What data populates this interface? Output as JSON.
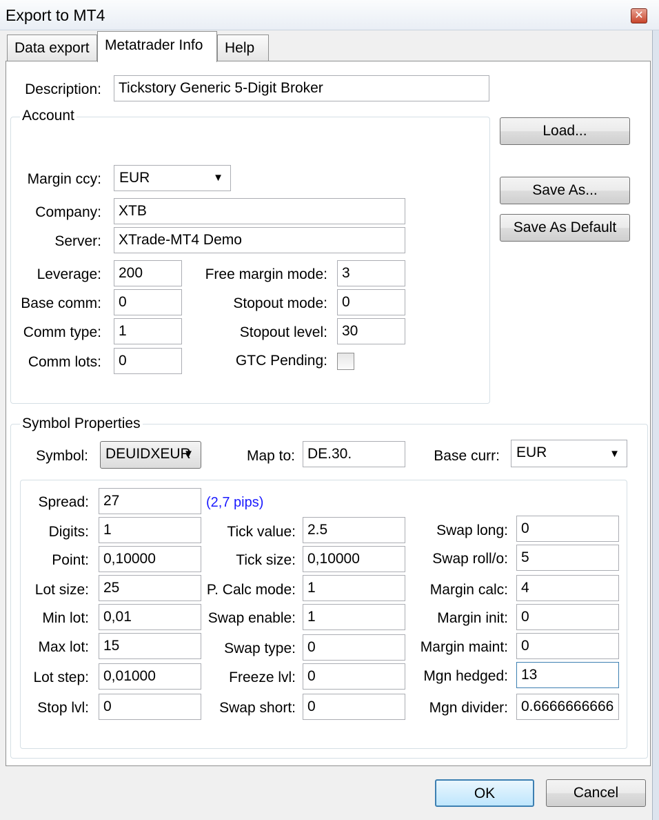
{
  "window": {
    "title": "Export to MT4",
    "close_glyph": "✕"
  },
  "tabs": [
    "Data export",
    "Metatrader Info",
    "Help"
  ],
  "description": {
    "label": "Description:",
    "value": "Tickstory Generic 5-Digit Broker"
  },
  "account": {
    "title": "Account",
    "margin_ccy": {
      "label": "Margin ccy:",
      "value": "EUR"
    },
    "company": {
      "label": "Company:",
      "value": "XTB"
    },
    "server": {
      "label": "Server:",
      "value": "XTrade-MT4 Demo"
    },
    "leverage": {
      "label": "Leverage:",
      "value": "200"
    },
    "base_comm": {
      "label": "Base comm:",
      "value": "0"
    },
    "comm_type": {
      "label": "Comm type:",
      "value": "1"
    },
    "comm_lots": {
      "label": "Comm lots:",
      "value": "0"
    },
    "free_margin_mode": {
      "label": "Free margin mode:",
      "value": "3"
    },
    "stopout_mode": {
      "label": "Stopout mode:",
      "value": "0"
    },
    "stopout_level": {
      "label": "Stopout level:",
      "value": "30"
    },
    "gtc_pending": {
      "label": "GTC Pending:",
      "checked": false
    }
  },
  "buttons": {
    "load": "Load...",
    "save_as": "Save As...",
    "save_default": "Save As Default",
    "ok": "OK",
    "cancel": "Cancel"
  },
  "symbol_props": {
    "title": "Symbol Properties",
    "symbol": {
      "label": "Symbol:",
      "value": "DEUIDXEUR"
    },
    "map_to": {
      "label": "Map to:",
      "value": "DE.30."
    },
    "base_curr": {
      "label": "Base curr:",
      "value": "EUR"
    },
    "spread": {
      "label": "Spread:",
      "value": "27",
      "note": "(2,7 pips)"
    },
    "col1": [
      {
        "label": "Digits:",
        "value": "1"
      },
      {
        "label": "Point:",
        "value": "0,10000"
      },
      {
        "label": "Lot size:",
        "value": "25"
      },
      {
        "label": "Min lot:",
        "value": "0,01"
      },
      {
        "label": "Max lot:",
        "value": "15"
      },
      {
        "label": "Lot step:",
        "value": "0,01000"
      },
      {
        "label": "Stop lvl:",
        "value": "0"
      }
    ],
    "col2": [
      {
        "label": "Tick value:",
        "value": "2.5"
      },
      {
        "label": "Tick size:",
        "value": "0,10000"
      },
      {
        "label": "P. Calc mode:",
        "value": "1"
      },
      {
        "label": "Swap enable:",
        "value": "1"
      },
      {
        "label": "Swap type:",
        "value": "0"
      },
      {
        "label": "Freeze lvl:",
        "value": "0"
      },
      {
        "label": "Swap short:",
        "value": "0"
      }
    ],
    "col3": [
      {
        "label": "Swap long:",
        "value": "0"
      },
      {
        "label": "Swap roll/o:",
        "value": "5"
      },
      {
        "label": "Margin calc:",
        "value": "4"
      },
      {
        "label": "Margin init:",
        "value": "0"
      },
      {
        "label": "Margin maint:",
        "value": "0"
      },
      {
        "label": "Mgn hedged:",
        "value": "13"
      },
      {
        "label": "Mgn divider:",
        "value": "0.6666666666"
      }
    ]
  }
}
